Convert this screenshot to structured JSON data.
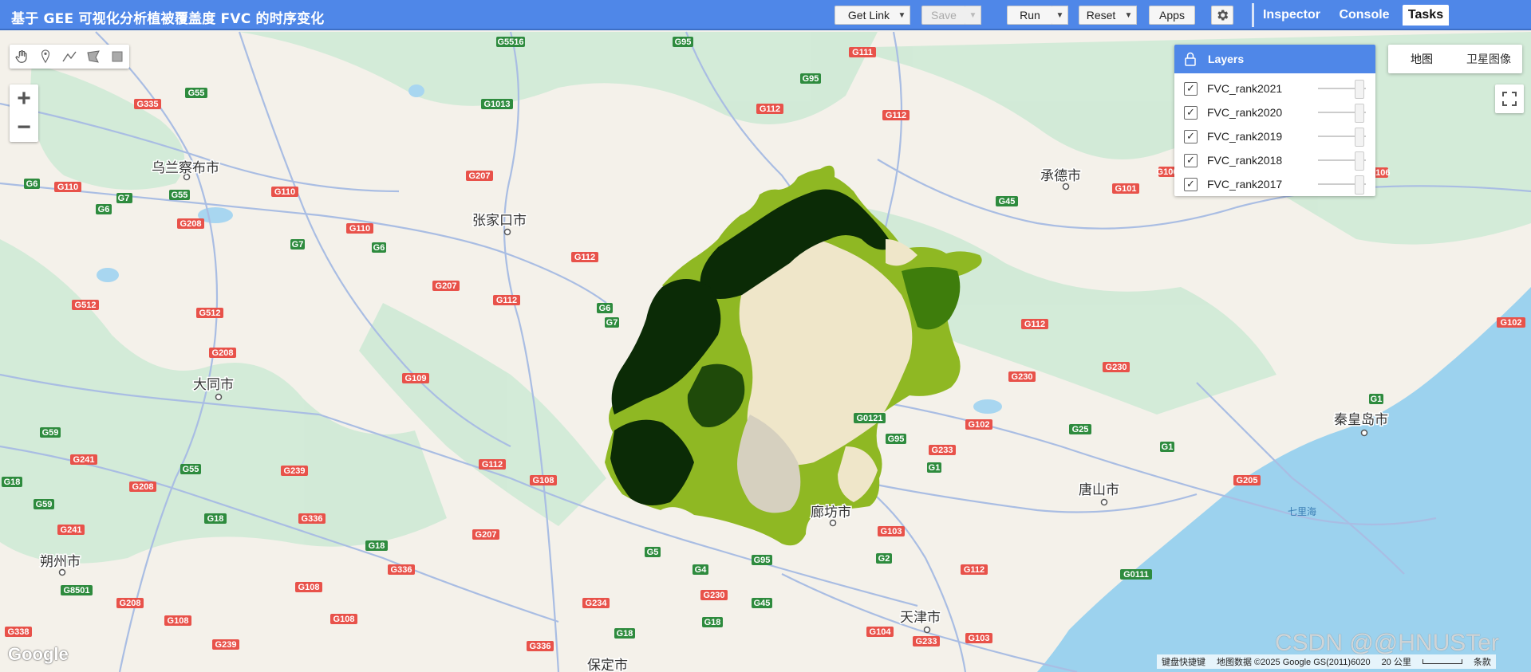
{
  "header": {
    "title": "基于 GEE 可视化分析植被覆盖度 FVC 的时序变化",
    "get_link": "Get Link",
    "save": "Save",
    "run": "Run",
    "reset": "Reset",
    "apps": "Apps",
    "tabs": [
      "Inspector",
      "Console",
      "Tasks"
    ],
    "active_tab": "Tasks"
  },
  "layers": {
    "title": "Layers",
    "items": [
      {
        "name": "FVC_rank2021",
        "checked": true
      },
      {
        "name": "FVC_rank2020",
        "checked": true
      },
      {
        "name": "FVC_rank2019",
        "checked": true
      },
      {
        "name": "FVC_rank2018",
        "checked": true
      },
      {
        "name": "FVC_rank2017",
        "checked": true
      }
    ]
  },
  "map_type": {
    "map": "地图",
    "satellite": "卫星图像"
  },
  "cities": [
    "乌兰察布市",
    "张家口市",
    "大同市",
    "承德市",
    "秦皇岛市",
    "唐山市",
    "天津市",
    "廊坊市",
    "朔州市",
    "保定市",
    "七里海"
  ],
  "roads": [
    "G5516",
    "G95",
    "G111",
    "G55",
    "G335",
    "G1013",
    "G95",
    "G112",
    "G112",
    "G6",
    "G110",
    "G7",
    "G55",
    "G110",
    "G207",
    "G6",
    "G7",
    "G208",
    "G110",
    "G7",
    "G6",
    "G112",
    "G207",
    "G112",
    "G512",
    "G512",
    "G6",
    "G7",
    "G45",
    "G101",
    "G109",
    "G208",
    "G112",
    "G230",
    "G230",
    "G102",
    "G1",
    "G0121",
    "G59",
    "G241",
    "G95",
    "G233",
    "G25",
    "G1",
    "G18",
    "G208",
    "G239",
    "G55",
    "G112",
    "G1",
    "G205",
    "G59",
    "G241",
    "G336",
    "G18",
    "G108",
    "G207",
    "G103",
    "G18",
    "G336",
    "G5",
    "G4",
    "G95",
    "G2",
    "G112",
    "G0111",
    "G8501",
    "G108",
    "G230",
    "G208",
    "G108",
    "G108",
    "G234",
    "G45",
    "G18",
    "G239",
    "G336",
    "G104",
    "G233",
    "G103",
    "G338",
    "G18",
    "G106",
    "G106",
    "G102"
  ],
  "status": {
    "shortcuts": "键盘快捷键",
    "attribution": "地图数据 ©2025 Google GS(2011)6020",
    "scale": "20 公里",
    "terms": "条款"
  },
  "logo": "Google",
  "watermark": "CSDN @@HNUSTer",
  "colors": {
    "accent": "#4f87e8",
    "dark_green": "#0b2b06",
    "mid_green": "#3e7d0c",
    "light_green": "#8fb823",
    "beige": "#efe6c9"
  }
}
